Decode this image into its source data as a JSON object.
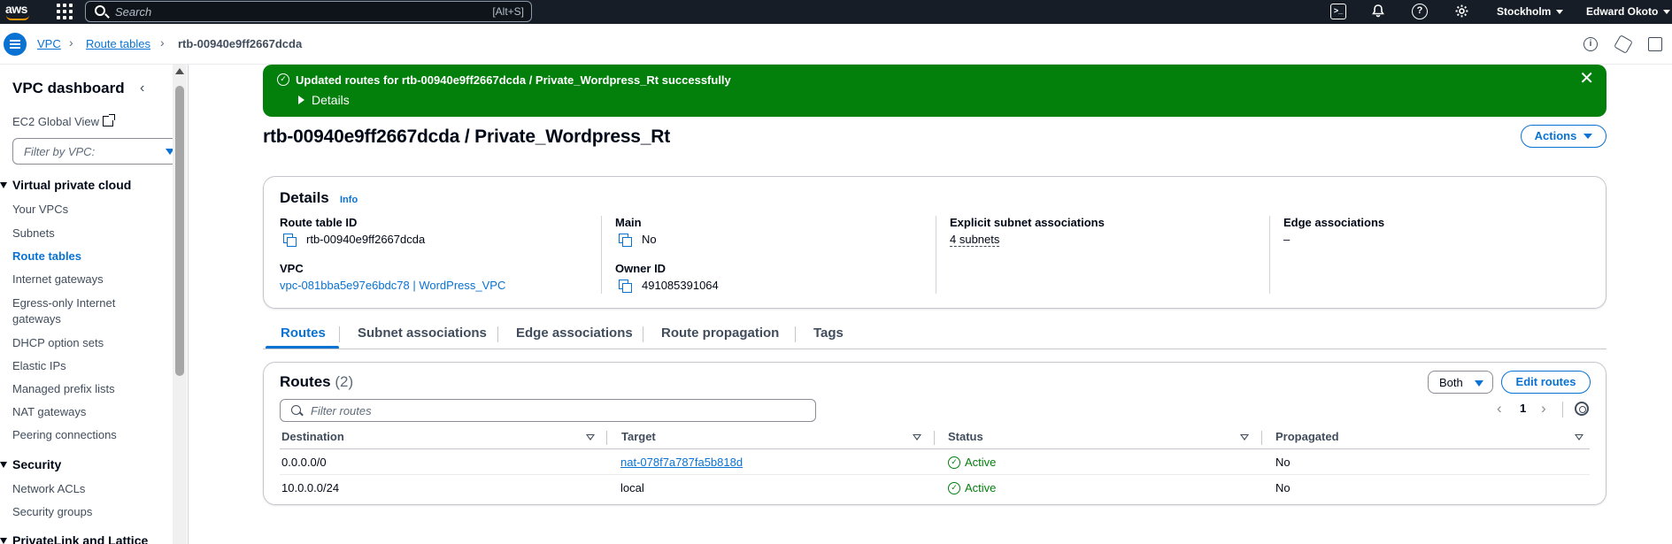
{
  "topnav": {
    "logo": "aws",
    "search_placeholder": "Search",
    "search_shortcut": "[Alt+S]",
    "region": "Stockholm",
    "user": "Edward Okoto"
  },
  "breadcrumb": {
    "items": [
      "VPC",
      "Route tables",
      "rtb-00940e9ff2667dcda"
    ],
    "separator": "›"
  },
  "sidebar": {
    "title": "VPC dashboard",
    "ec2_global_view": "EC2 Global View",
    "filter_placeholder": "Filter by VPC:",
    "section_vpc": "Virtual private cloud",
    "vpc_items": [
      "Your VPCs",
      "Subnets",
      "Route tables",
      "Internet gateways",
      "Egress-only Internet",
      "gateways",
      "DHCP option sets",
      "Elastic IPs",
      "Managed prefix lists",
      "NAT gateways",
      "Peering connections"
    ],
    "section_security": "Security",
    "security_items": [
      "Network ACLs",
      "Security groups"
    ],
    "section_privatelink": "PrivateLink and Lattice"
  },
  "flash": {
    "message": "Updated routes for rtb-00940e9ff2667dcda / Private_Wordpress_Rt successfully",
    "details_label": "Details",
    "close": "✕"
  },
  "page": {
    "title": "rtb-00940e9ff2667dcda / Private_Wordpress_Rt",
    "actions_label": "Actions"
  },
  "details": {
    "heading": "Details",
    "info": "Info",
    "route_table_id_label": "Route table ID",
    "route_table_id": "rtb-00940e9ff2667dcda",
    "vpc_label": "VPC",
    "vpc_value": "vpc-081bba5e97e6bdc78 | WordPress_VPC",
    "main_label": "Main",
    "main_value": "No",
    "owner_label": "Owner ID",
    "owner_value": "491085391064",
    "explicit_label": "Explicit subnet associations",
    "explicit_value": "4 subnets",
    "edge_label": "Edge associations",
    "edge_value": "–"
  },
  "tabs": [
    "Routes",
    "Subnet associations",
    "Edge associations",
    "Route propagation",
    "Tags"
  ],
  "routes": {
    "heading": "Routes",
    "count": "(2)",
    "both_label": "Both",
    "edit_label": "Edit routes",
    "filter_placeholder": "Filter routes",
    "page_number": "1",
    "prev": "‹",
    "next": "›",
    "columns": [
      "Destination",
      "Target",
      "Status",
      "Propagated"
    ],
    "rows": [
      {
        "destination": "0.0.0.0/0",
        "target": "nat-078f7a787fa5b818d",
        "status": "Active",
        "propagated": "No"
      },
      {
        "destination": "10.0.0.0/24",
        "target": "local",
        "status": "Active",
        "propagated": "No"
      }
    ]
  },
  "colors": {
    "accent": "#0972d3",
    "success": "#037f0c",
    "topnav": "#161d26"
  }
}
